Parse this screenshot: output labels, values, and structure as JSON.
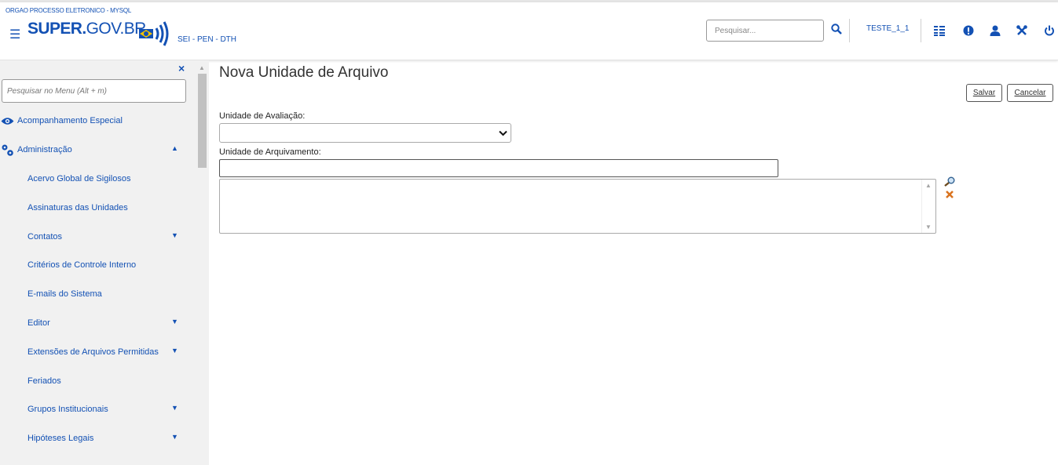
{
  "header": {
    "org": "ORGAO PROCESSO ELETRONICO - MYSQL",
    "menu_icon": "hamburger-icon",
    "logo_bold": "SUPER.",
    "logo_light": "GOV.BR",
    "subsystem": "SEI - PEN - DTH",
    "search_placeholder": "Pesquisar...",
    "user": "TESTE_1_1",
    "icons": [
      "search-icon",
      "grid-icon",
      "alert-icon",
      "user-icon",
      "tools-icon",
      "power-icon"
    ]
  },
  "sidebar": {
    "close": "×",
    "search_placeholder": "Pesquisar no Menu (Alt + m)",
    "items": [
      {
        "label": "Acompanhamento Especial",
        "icon": "eye-icon"
      },
      {
        "label": "Administração",
        "icon": "gears-icon",
        "expanded": true
      },
      {
        "label": "Acervo Global de Sigilosos"
      },
      {
        "label": "Assinaturas das Unidades"
      },
      {
        "label": "Contatos",
        "has_submenu": true
      },
      {
        "label": "Critérios de Controle Interno"
      },
      {
        "label": "E-mails do Sistema"
      },
      {
        "label": "Editor",
        "has_submenu": true
      },
      {
        "label": "Extensões de Arquivos Permitidas",
        "has_submenu": true
      },
      {
        "label": "Feriados"
      },
      {
        "label": "Grupos Institucionais",
        "has_submenu": true
      },
      {
        "label": "Hipóteses Legais",
        "has_submenu": true
      }
    ]
  },
  "main": {
    "title": "Nova Unidade de Arquivo",
    "save_label": "Salvar",
    "cancel_label": "Cancelar",
    "field_avaliacao_label": "Unidade de Avaliação:",
    "field_avaliacao_value": "",
    "field_arquivamento_label": "Unidade de Arquivamento:",
    "field_arquivamento_value": "",
    "lookup_icon": "magnifier-icon",
    "remove_icon": "remove-x-icon"
  },
  "colors": {
    "brand": "#1351b4",
    "sidebar_bg": "#f1f1f1"
  }
}
